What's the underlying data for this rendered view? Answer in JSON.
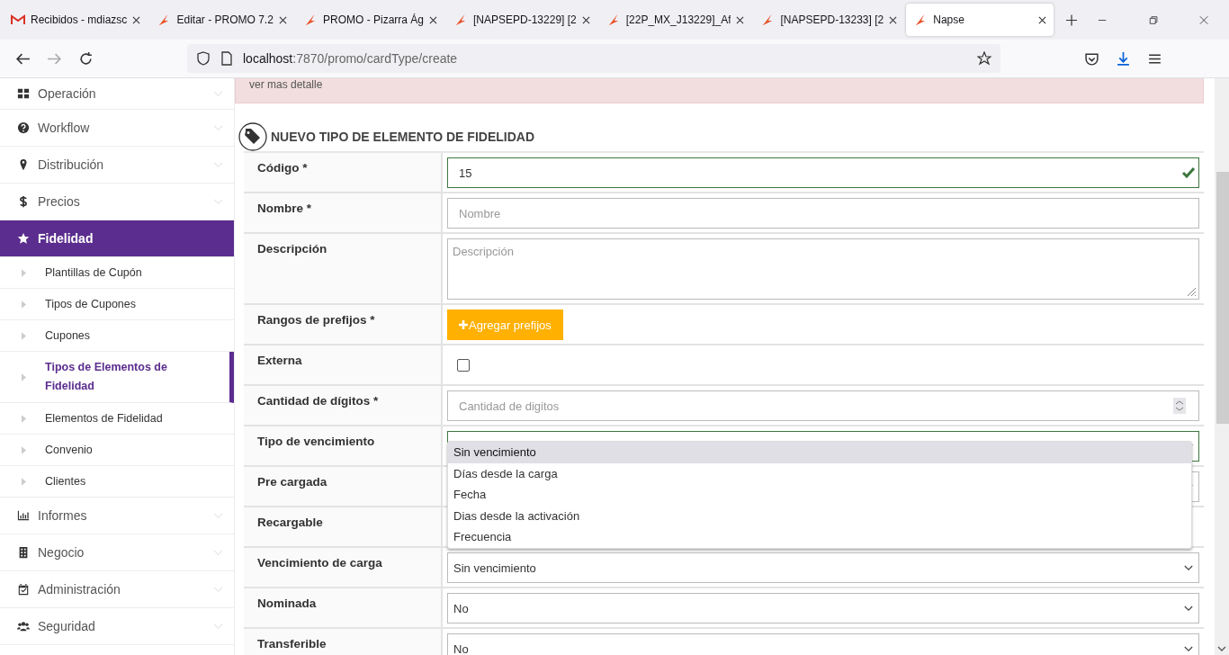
{
  "browser": {
    "tabs": [
      {
        "title": "Recibidos - mdiazsc",
        "selected": false
      },
      {
        "title": "Editar - PROMO 7.2",
        "selected": false
      },
      {
        "title": "PROMO - Pizarra Ág",
        "selected": false
      },
      {
        "title": "[NAPSEPD-13229] [2",
        "selected": false
      },
      {
        "title": "[22P_MX_J13229]_Af",
        "selected": false
      },
      {
        "title": "[NAPSEPD-13233] [2",
        "selected": false
      },
      {
        "title": "Napse",
        "selected": true
      }
    ],
    "url_host": "localhost",
    "url_rest": ":7870/promo/cardType/create"
  },
  "sidebar": {
    "items": [
      {
        "label": "Operación",
        "selected": false
      },
      {
        "label": "Workflow",
        "selected": false
      },
      {
        "label": "Distribución",
        "selected": false
      },
      {
        "label": "Precios",
        "selected": false
      },
      {
        "label": "Fidelidad",
        "selected": true,
        "children": [
          {
            "label": "Plantillas de Cupón",
            "selected": false
          },
          {
            "label": "Tipos de Cupones",
            "selected": false
          },
          {
            "label": "Cupones",
            "selected": false
          },
          {
            "label": "Tipos de Elementos de Fidelidad",
            "selected": true
          },
          {
            "label": "Elementos de Fidelidad",
            "selected": false
          },
          {
            "label": "Convenio",
            "selected": false
          },
          {
            "label": "Clientes",
            "selected": false
          }
        ]
      },
      {
        "label": "Informes",
        "selected": false
      },
      {
        "label": "Negocio",
        "selected": false
      },
      {
        "label": "Administración",
        "selected": false
      },
      {
        "label": "Seguridad",
        "selected": false
      }
    ]
  },
  "alert": {
    "text": "ver mas detalle"
  },
  "form": {
    "title": "NUEVO TIPO DE ELEMENTO DE FIDELIDAD",
    "rows": [
      {
        "label": "Código *",
        "kind": "text",
        "value": "15",
        "valid": true
      },
      {
        "label": "Nombre *",
        "kind": "text",
        "placeholder": "Nombre",
        "valid": false
      },
      {
        "label": "Descripción",
        "kind": "textarea",
        "placeholder": "Descripción"
      },
      {
        "label": "Rangos de prefijos *",
        "kind": "button",
        "button": "Agregar prefijos"
      },
      {
        "label": "Externa",
        "kind": "checkbox",
        "checked": false
      },
      {
        "label": "Cantidad de dígitos *",
        "kind": "number",
        "placeholder": "Cantidad de digitos"
      },
      {
        "label": "Tipo de vencimiento",
        "kind": "select",
        "valid": true,
        "open": true,
        "options": [
          {
            "label": "Sin vencimiento",
            "selected": true
          },
          {
            "label": "Días desde la carga",
            "selected": false
          },
          {
            "label": "Fecha",
            "selected": false
          },
          {
            "label": "Dias desde la activación",
            "selected": false
          },
          {
            "label": "Frecuencia",
            "selected": false
          }
        ]
      },
      {
        "label": "Pre cargada",
        "kind": "select",
        "valid": false
      },
      {
        "label": "Recargable",
        "kind": "covered"
      },
      {
        "label": "Vencimiento de carga",
        "kind": "select",
        "value": "Sin vencimiento",
        "valid": false
      },
      {
        "label": "Nominada",
        "kind": "select",
        "value": "No",
        "valid": false
      },
      {
        "label": "Transferible",
        "kind": "select",
        "value": "No",
        "valid": false
      }
    ]
  }
}
